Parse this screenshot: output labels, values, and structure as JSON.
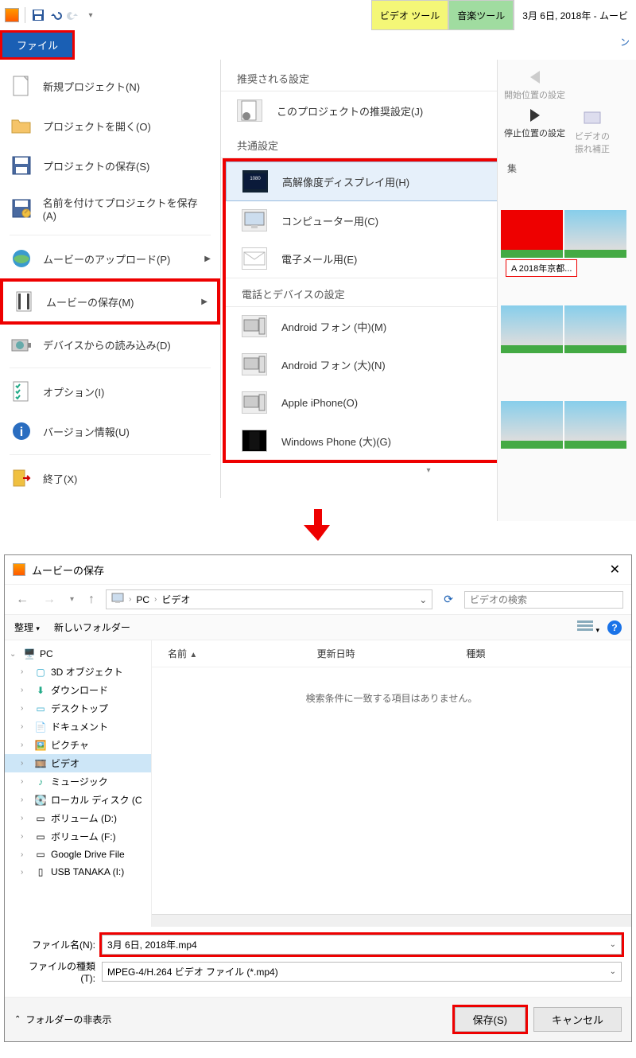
{
  "titlebar": {
    "tab_video": "ビデオ ツール",
    "tab_music": "音楽ツール",
    "title_text": "3月 6日, 2018年 - ムービ"
  },
  "ribbon": {
    "file_tab": "ファイル",
    "tab_suffix": "ン"
  },
  "file_menu": {
    "new_project": "新規プロジェクト(N)",
    "open_project": "プロジェクトを開く(O)",
    "save_project": "プロジェクトの保存(S)",
    "save_as_project": "名前を付けてプロジェクトを保存(A)",
    "upload_movie": "ムービーのアップロード(P)",
    "save_movie": "ムービーの保存(M)",
    "import_device": "デバイスからの読み込み(D)",
    "options": "オプション(I)",
    "version": "バージョン情報(U)",
    "exit": "終了(X)"
  },
  "submenu": {
    "header_recommended": "推奨される設定",
    "this_project": "このプロジェクトの推奨設定(J)",
    "header_common": "共通設定",
    "hd_display": "高解像度ディスプレイ用(H)",
    "computer": "コンピューター用(C)",
    "email": "電子メール用(E)",
    "header_devices": "電話とデバイスの設定",
    "android_m": "Android フォン (中)(M)",
    "android_l": "Android フォン (大)(N)",
    "iphone": "Apple iPhone(O)",
    "winphone": "Windows Phone (大)(G)"
  },
  "right_panel": {
    "start_pos": "開始位置の設定",
    "stop_pos": "停止位置の設定",
    "video_stab_1": "ビデオの",
    "video_stab_2": "振れ補正",
    "edit_suffix": "集",
    "clip_label": "A 2018年京都..."
  },
  "dialog": {
    "title": "ムービーの保存",
    "breadcrumb_pc": "PC",
    "breadcrumb_video": "ビデオ",
    "search_placeholder": "ビデオの検索",
    "toolbar_organize": "整理",
    "toolbar_newfolder": "新しいフォルダー",
    "tree": {
      "pc": "PC",
      "objects3d": "3D オブジェクト",
      "downloads": "ダウンロード",
      "desktop": "デスクトップ",
      "documents": "ドキュメント",
      "pictures": "ピクチャ",
      "videos": "ビデオ",
      "music": "ミュージック",
      "localdisk": "ローカル ディスク (C",
      "volume_d": "ボリューム (D:)",
      "volume_f": "ボリューム (F:)",
      "gdrive": "Google Drive File",
      "usb": "USB TANAKA (I:)"
    },
    "list": {
      "col_name": "名前",
      "col_date": "更新日時",
      "col_type": "種類",
      "empty": "検索条件に一致する項目はありません。"
    },
    "filename_label": "ファイル名(N):",
    "filename_value": "3月 6日, 2018年.mp4",
    "filetype_label": "ファイルの種類(T):",
    "filetype_value": "MPEG-4/H.264 ビデオ ファイル (*.mp4)",
    "hide_folders": "フォルダーの非表示",
    "btn_save": "保存(S)",
    "btn_cancel": "キャンセル"
  }
}
